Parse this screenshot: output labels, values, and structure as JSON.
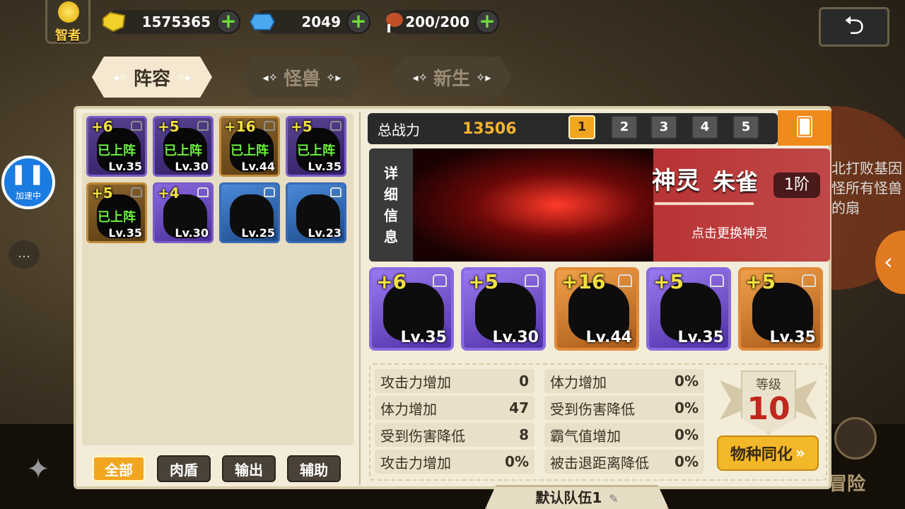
{
  "top": {
    "title": "智者",
    "gold": "1575365",
    "gems": "2049",
    "stamina": "200/200",
    "plus": "+"
  },
  "tabs": [
    {
      "label": "阵容",
      "deco": "◂✧",
      "deco_r": "✧▸"
    },
    {
      "label": "怪兽",
      "deco": "◂✧",
      "deco_r": "✧▸"
    },
    {
      "label": "新生",
      "deco": "◂✧",
      "deco_r": "✧▸"
    }
  ],
  "side": {
    "speed_label": "加速中",
    "speed_icon": "❚❚",
    "hint_text": "北打败基因怪所有怪兽的扇",
    "adventure": "冒险"
  },
  "roster": [
    {
      "plus": "+6",
      "lv": "Lv.35",
      "status": "已上阵",
      "color": "purple"
    },
    {
      "plus": "+5",
      "lv": "Lv.30",
      "status": "已上阵",
      "color": "purple"
    },
    {
      "plus": "+16",
      "lv": "Lv.44",
      "status": "已上阵",
      "color": "gold"
    },
    {
      "plus": "+5",
      "lv": "Lv.35",
      "status": "已上阵",
      "color": "purple"
    },
    {
      "plus": "+5",
      "lv": "Lv.35",
      "status": "已上阵",
      "color": "gold"
    },
    {
      "plus": "+4",
      "lv": "Lv.30",
      "status": "",
      "color": "purple"
    },
    {
      "plus": "",
      "lv": "Lv.25",
      "status": "",
      "color": "blue"
    },
    {
      "plus": "",
      "lv": "Lv.23",
      "status": "",
      "color": "blue"
    }
  ],
  "filters": [
    "全部",
    "肉盾",
    "输出",
    "辅助"
  ],
  "power": {
    "label": "总战力",
    "value": "13506"
  },
  "teams": [
    "1",
    "2",
    "3",
    "4",
    "5"
  ],
  "spirit": {
    "detail_tab": "详细信息",
    "category": "神灵",
    "name": "朱雀",
    "rank": "1阶",
    "hint": "点击更换神灵"
  },
  "team_members": [
    {
      "plus": "+6",
      "lv": "Lv.35",
      "color": "purple"
    },
    {
      "plus": "+5",
      "lv": "Lv.30",
      "color": "purple"
    },
    {
      "plus": "+16",
      "lv": "Lv.44",
      "color": "gold"
    },
    {
      "plus": "+5",
      "lv": "Lv.35",
      "color": "purple"
    },
    {
      "plus": "+5",
      "lv": "Lv.35",
      "color": "gold"
    }
  ],
  "stats_left": [
    {
      "label": "攻击力增加",
      "value": "0"
    },
    {
      "label": "体力增加",
      "value": "47"
    },
    {
      "label": "受到伤害降低",
      "value": "8"
    },
    {
      "label": "攻击力增加",
      "value": "0%"
    }
  ],
  "stats_right": [
    {
      "label": "体力增加",
      "value": "0%"
    },
    {
      "label": "受到伤害降低",
      "value": "0%"
    },
    {
      "label": "霸气值增加",
      "value": "0%"
    },
    {
      "label": "被击退距离降低",
      "value": "0%"
    }
  ],
  "level": {
    "label": "等级",
    "value": "10"
  },
  "assimilate": {
    "label": "物种同化",
    "chev": "»"
  },
  "team_name": "默认队伍1",
  "colors": {
    "accent": "#f2a620",
    "panel": "#f3ecd8",
    "deployed": "#6cf040",
    "level_red": "#c0281e"
  }
}
